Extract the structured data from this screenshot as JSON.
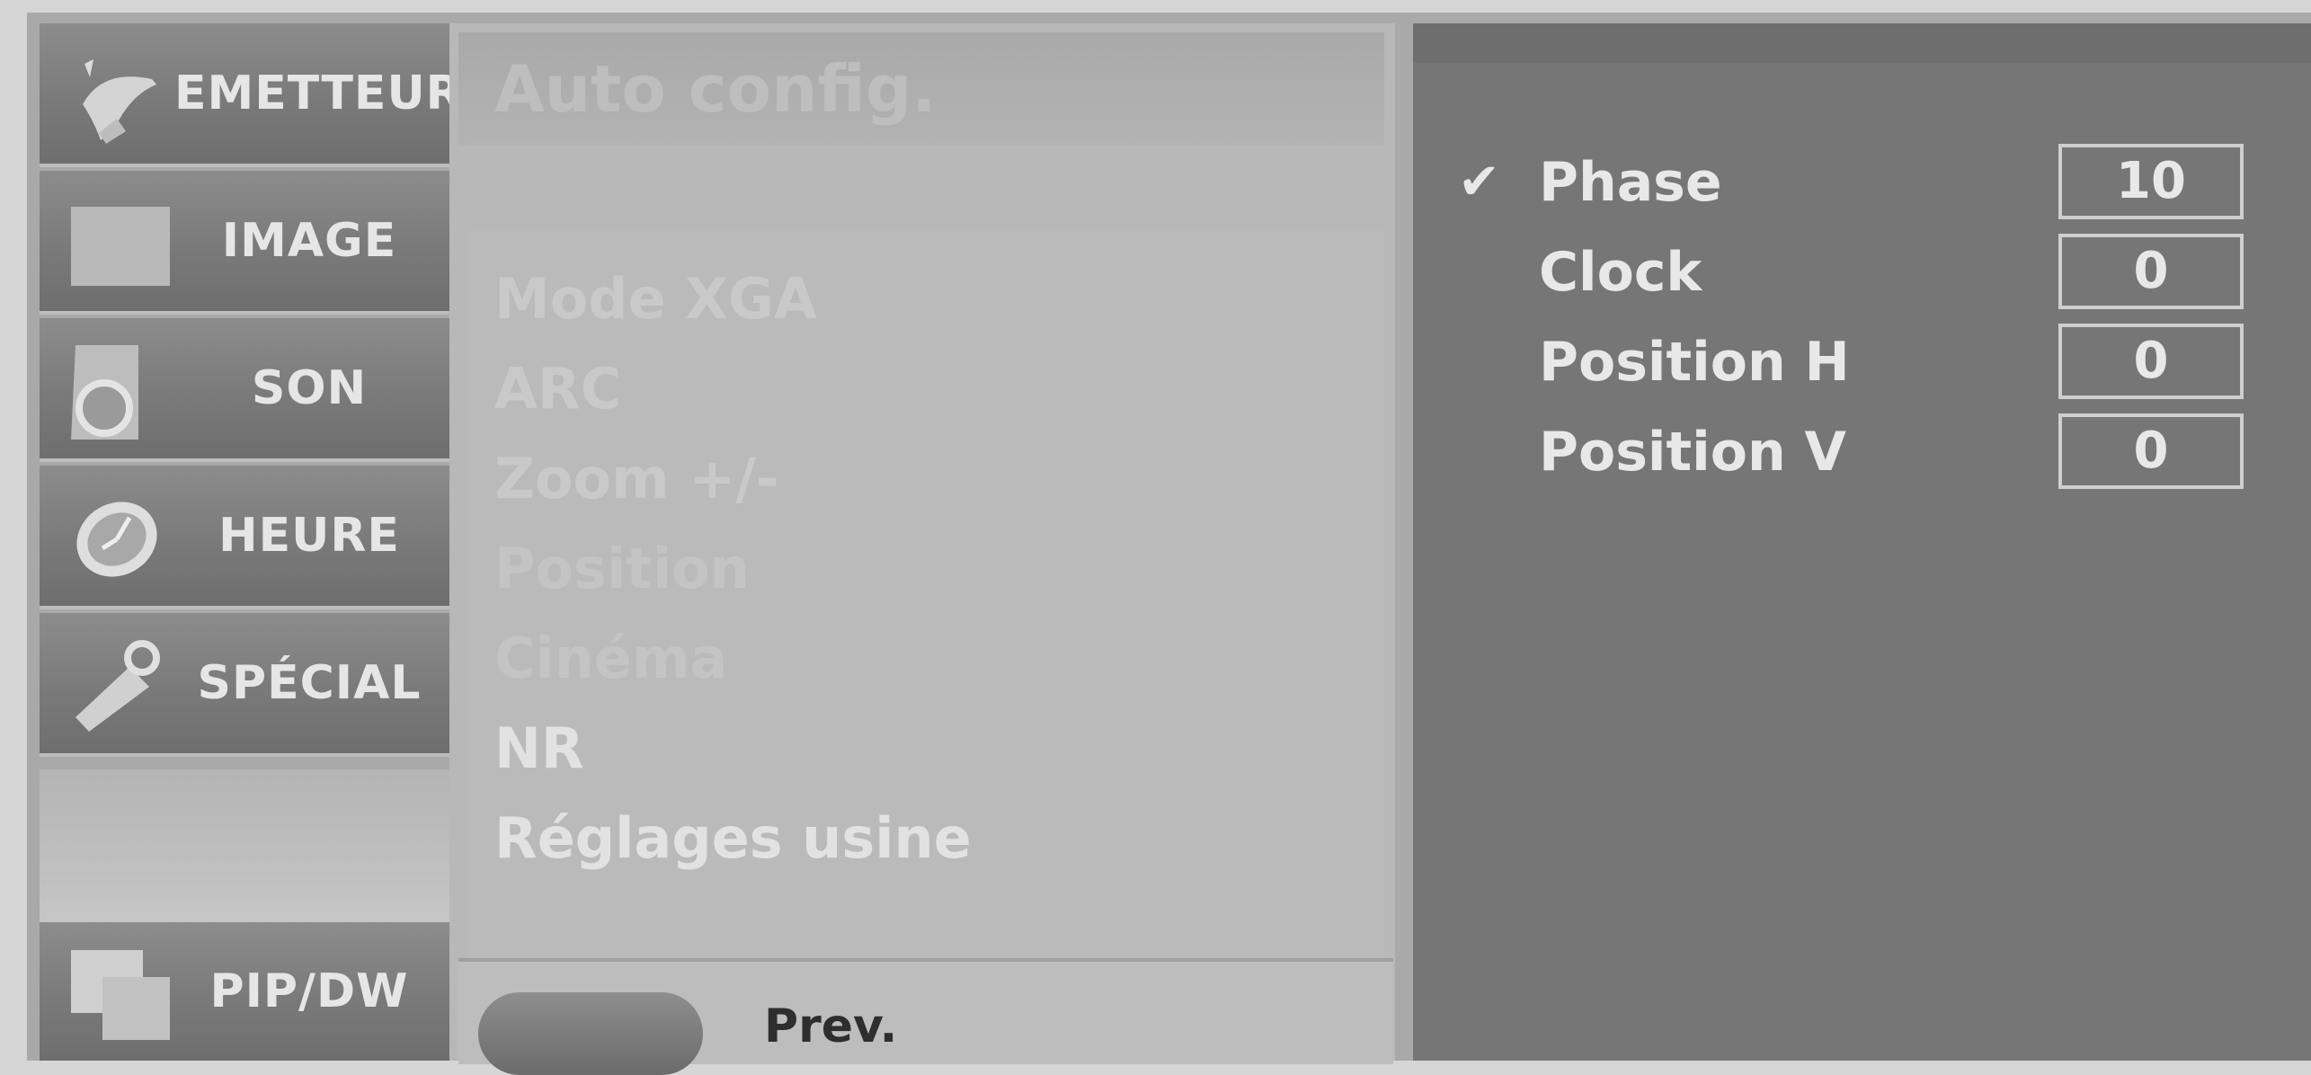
{
  "sidebar": {
    "items": [
      {
        "label": "EMETTEUR",
        "icon": "satellite-dish-icon"
      },
      {
        "label": "IMAGE",
        "icon": "picture-square-icon"
      },
      {
        "label": "SON",
        "icon": "speaker-icon"
      },
      {
        "label": "HEURE",
        "icon": "clock-icon"
      },
      {
        "label": "SPÉCIAL",
        "icon": "tag-icon"
      },
      {
        "label": "PIP/DW",
        "icon": "pip-windows-icon"
      }
    ]
  },
  "middle": {
    "title": "Auto config.",
    "title_value": "",
    "items": [
      {
        "label": "Mode XGA"
      },
      {
        "label": "ARC"
      },
      {
        "label": "Zoom +/-"
      },
      {
        "label": "Position"
      },
      {
        "label": "Cinéma"
      },
      {
        "label": "NR"
      },
      {
        "label": "Réglages usine"
      }
    ],
    "footer": {
      "prev_label": "Prev."
    }
  },
  "right": {
    "params": [
      {
        "name": "Phase",
        "value": "10",
        "selected": true,
        "check": "✔"
      },
      {
        "name": "Clock",
        "value": "0"
      },
      {
        "name": "Position H",
        "value": "0"
      },
      {
        "name": "Position V",
        "value": "0"
      }
    ]
  },
  "colors": {
    "panel_dark": "#767676",
    "panel_mid": "#b8b8b8",
    "text_light": "#e8e8e8"
  }
}
